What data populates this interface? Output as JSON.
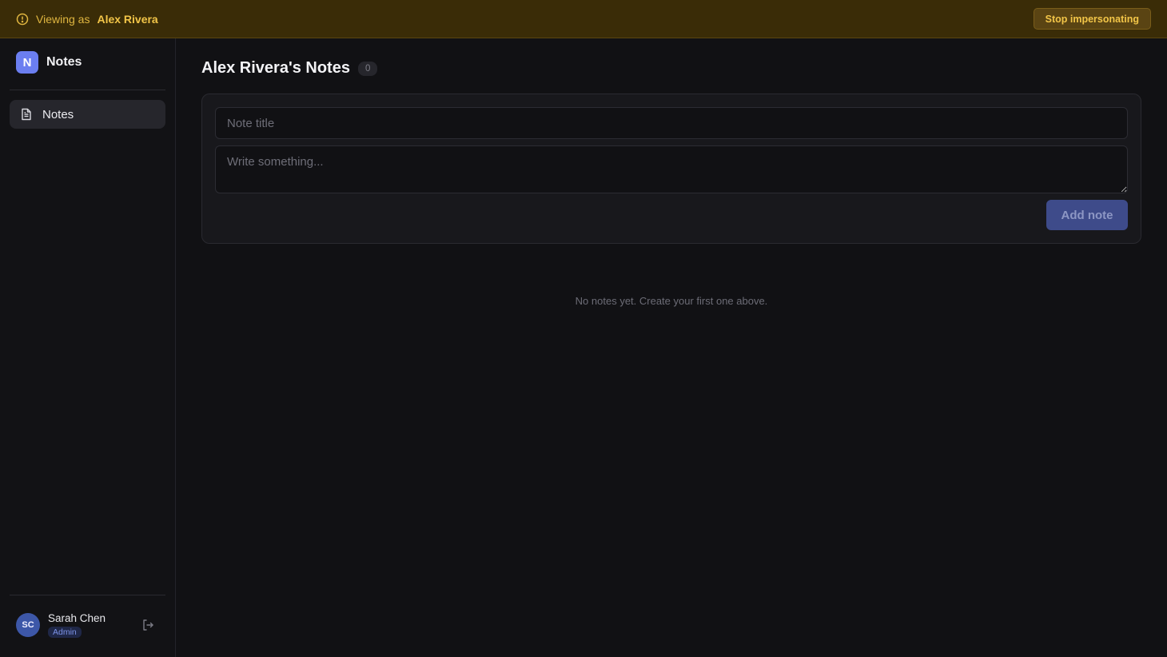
{
  "banner": {
    "viewing_prefix": "Viewing as",
    "viewing_name": "Alex Rivera",
    "stop_label": "Stop impersonating",
    "icon": "alert-circle-icon"
  },
  "sidebar": {
    "brand_letter": "N",
    "brand_name": "Notes",
    "items": [
      {
        "label": "Notes",
        "icon": "file-text-icon",
        "active": true
      }
    ],
    "user": {
      "initials": "SC",
      "name": "Sarah Chen",
      "role": "Admin"
    }
  },
  "main": {
    "title": "Alex Rivera's Notes",
    "count": "0",
    "title_placeholder": "Note title",
    "body_placeholder": "Write something...",
    "add_label": "Add note",
    "empty_message": "No notes yet. Create your first one above."
  },
  "colors": {
    "accent": "#6b7ef0",
    "banner_bg": "#3a2c07",
    "banner_text": "#f2c548",
    "background": "#111114"
  }
}
